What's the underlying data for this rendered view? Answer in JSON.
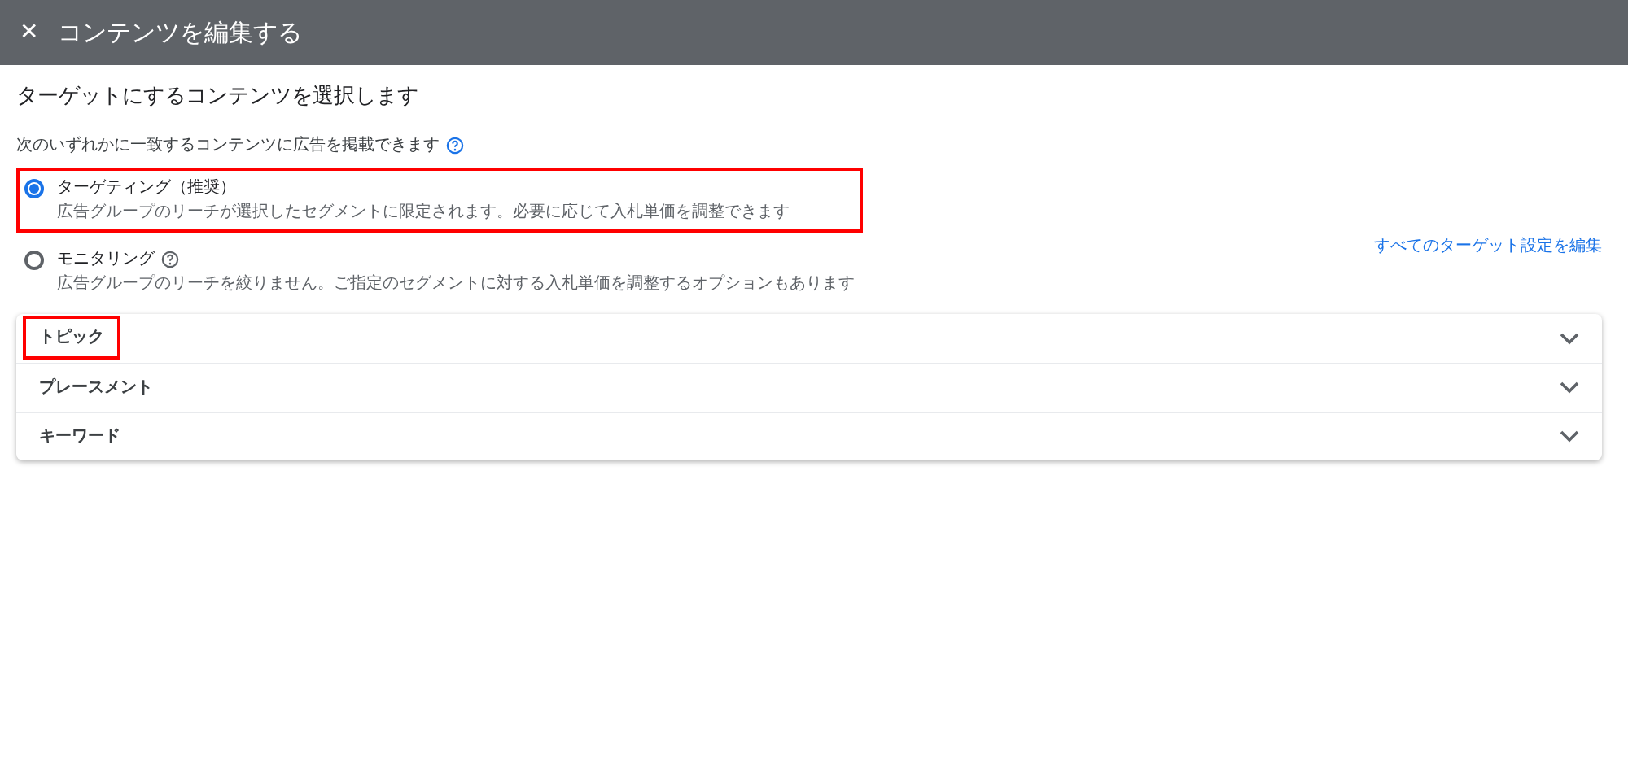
{
  "header": {
    "close_icon": "✕",
    "title": "コンテンツを編集する"
  },
  "heading": "ターゲットにするコンテンツを選択します",
  "subheading": "次のいずれかに一致するコンテンツに広告を掲載できます",
  "options": [
    {
      "label": "ターゲティング（推奨）",
      "description": "広告グループのリーチが選択したセグメントに限定されます。必要に応じて入札単価を調整できます",
      "selected": true,
      "help": false,
      "highlighted": true
    },
    {
      "label": "モニタリング",
      "description": "広告グループのリーチを絞りません。ご指定のセグメントに対する入札単価を調整するオプションもあります",
      "selected": false,
      "help": true,
      "highlighted": false
    }
  ],
  "edit_link": "すべてのターゲット設定を編集",
  "sections": [
    {
      "label": "トピック",
      "expanded": false,
      "highlighted": true
    },
    {
      "label": "プレースメント",
      "expanded": false,
      "highlighted": false
    },
    {
      "label": "キーワード",
      "expanded": false,
      "highlighted": false
    }
  ]
}
